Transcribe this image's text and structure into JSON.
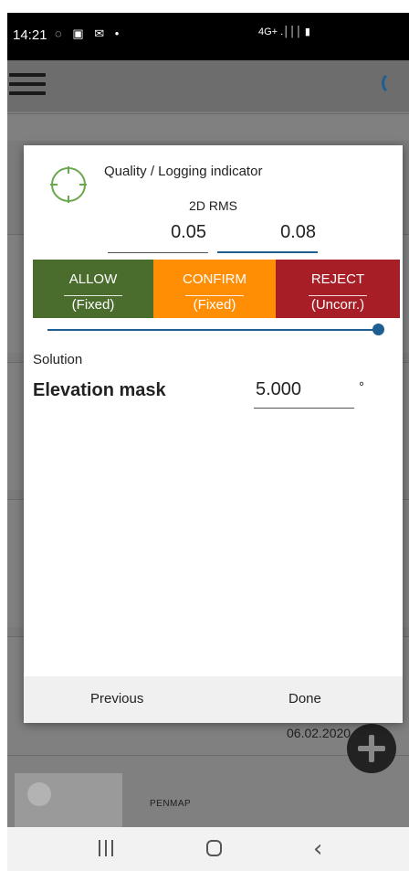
{
  "status_bar": {
    "time": "14:21",
    "notification_icons": [
      "cast-icon",
      "image-icon",
      "mail-icon",
      "dot-icon"
    ],
    "notification_glyphs": "◌ ▣ ✉ •",
    "network_glyphs": "4G+ .│││ ▮",
    "network_icons": [
      "4g-icon",
      "signal-icon",
      "battery-icon"
    ]
  },
  "background": {
    "timestamp": "06.02.2020 13.07",
    "app_label": "PENMAP"
  },
  "dialog": {
    "title": "Quality / Logging indicator",
    "metric": "2D RMS",
    "threshold_1": "0.05",
    "threshold_2": "0.08",
    "zones": [
      {
        "name": "ALLOW",
        "sub": "(Fixed)",
        "color": "#4a6d2e"
      },
      {
        "name": "CONFIRM",
        "sub": "(Fixed)",
        "color": "#ff8e05"
      },
      {
        "name": "REJECT",
        "sub": "(Uncorr.)",
        "color": "#a71e26"
      }
    ],
    "slider_value": 1.0,
    "section_label": "Solution",
    "elevation_label": "Elevation mask",
    "elevation_value": "5.000",
    "elevation_unit": "°",
    "buttons": {
      "previous": "Previous",
      "done": "Done"
    }
  },
  "colors": {
    "accent": "#1f5e91",
    "target_icon": "#6aa84f"
  }
}
